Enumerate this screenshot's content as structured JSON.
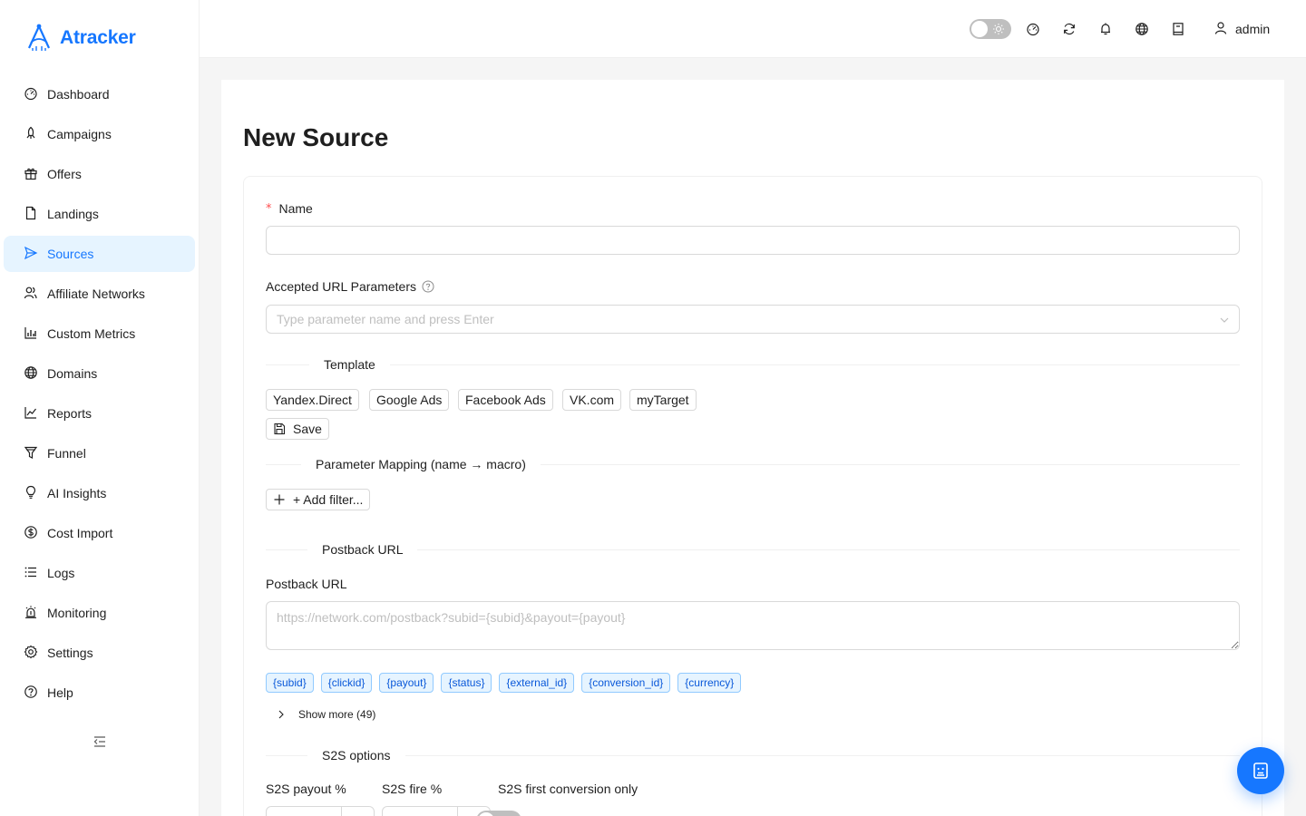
{
  "app": {
    "name": "Atracker",
    "accent": "#1677ff"
  },
  "sidebar": {
    "items": [
      {
        "label": "Dashboard",
        "icon": "dashboard-icon"
      },
      {
        "label": "Campaigns",
        "icon": "rocket-icon"
      },
      {
        "label": "Offers",
        "icon": "gift-icon"
      },
      {
        "label": "Landings",
        "icon": "file-icon"
      },
      {
        "label": "Sources",
        "icon": "send-icon",
        "active": true
      },
      {
        "label": "Affiliate Networks",
        "icon": "users-icon"
      },
      {
        "label": "Custom Metrics",
        "icon": "bar-chart-icon"
      },
      {
        "label": "Domains",
        "icon": "globe-icon"
      },
      {
        "label": "Reports",
        "icon": "line-chart-icon"
      },
      {
        "label": "Funnel",
        "icon": "funnel-icon"
      },
      {
        "label": "AI Insights",
        "icon": "bulb-icon"
      },
      {
        "label": "Cost Import",
        "icon": "dollar-icon"
      },
      {
        "label": "Logs",
        "icon": "list-icon"
      },
      {
        "label": "Monitoring",
        "icon": "alert-icon"
      },
      {
        "label": "Settings",
        "icon": "gear-icon"
      },
      {
        "label": "Help",
        "icon": "question-icon"
      }
    ]
  },
  "header": {
    "theme_toggle": "light",
    "icons": [
      "dashboard-icon",
      "refresh-icon",
      "bell-icon",
      "globe-icon",
      "book-icon"
    ],
    "user": "admin"
  },
  "page": {
    "title": "New Source",
    "name_label": "Name",
    "name_value": "",
    "accepted_params_label": "Accepted URL Parameters",
    "accepted_params_placeholder": "Type parameter name and press Enter",
    "template_divider": "Template",
    "templates": [
      "Yandex.Direct",
      "Google Ads",
      "Facebook Ads",
      "VK.com",
      "myTarget"
    ],
    "save_label": "Save",
    "mapping_divider": "Parameter Mapping (name → macro)",
    "add_filter_label": "+ Add filter...",
    "postback_divider": "Postback URL",
    "postback_label": "Postback URL",
    "postback_placeholder": "https://network.com/postback?subid={subid}&payout={payout}",
    "macros": [
      "{subid}",
      "{clickid}",
      "{payout}",
      "{status}",
      "{external_id}",
      "{conversion_id}",
      "{currency}"
    ],
    "show_more_label": "Show more (49)",
    "s2s_divider": "S2S options",
    "s2s_payout_label": "S2S payout %",
    "s2s_fire_label": "S2S fire %",
    "s2s_first_label": "S2S first conversion only",
    "s2s_first_enabled": false
  }
}
